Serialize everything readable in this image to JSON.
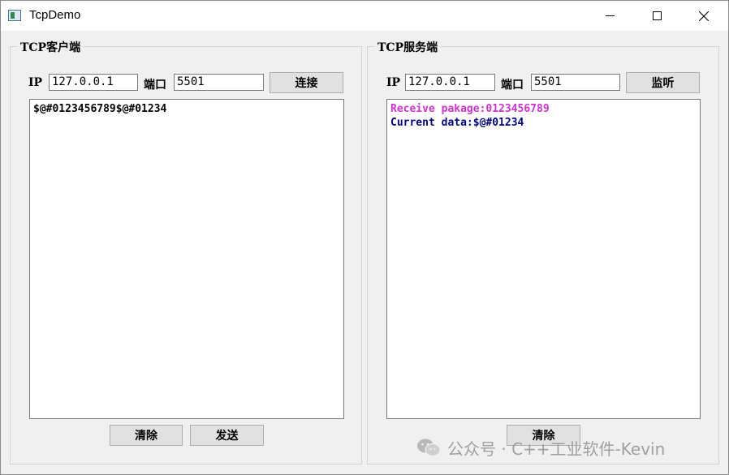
{
  "window": {
    "title": "TcpDemo",
    "icon": "app-window-icon"
  },
  "client": {
    "group_title": "TCP客户端",
    "ip_label": "IP",
    "ip_value": "127.0.0.1",
    "port_label": "端口",
    "port_value": "5501",
    "connect_label": "连接",
    "log": [
      "$@#0123456789$@#01234"
    ],
    "clear_label": "清除",
    "send_label": "发送"
  },
  "server": {
    "group_title": "TCP服务端",
    "ip_label": "IP",
    "ip_value": "127.0.0.1",
    "port_label": "端口",
    "port_value": "5501",
    "listen_label": "监听",
    "log": [
      {
        "text": "Receive pakage:0123456789",
        "color": "#cc33cc"
      },
      {
        "text": "Current data:$@#01234",
        "color": "#000080"
      }
    ],
    "clear_label": "清除"
  },
  "watermark": {
    "text": "公众号 · C++工业软件-Kevin",
    "icon": "wechat-icon"
  }
}
